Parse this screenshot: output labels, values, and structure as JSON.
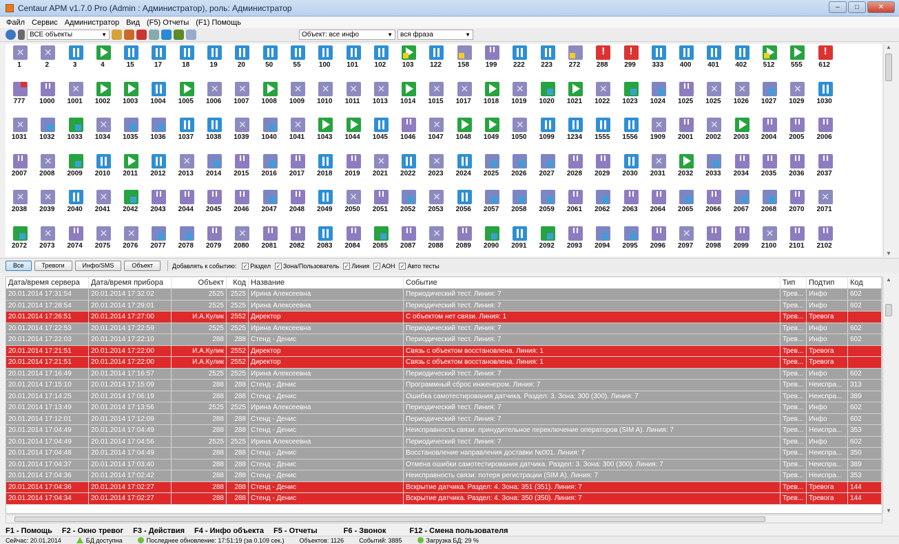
{
  "window": {
    "title": "Centaur APM v1.7.0 Pro (Admin : Администратор), роль: Администратор",
    "min": "–",
    "max": "□",
    "close": "✕"
  },
  "menu": [
    "Файл",
    "Сервис",
    "Администратор",
    "Вид",
    "(F5) Отчеты",
    "(F1) Помощь"
  ],
  "toolbar": {
    "objects_combo": "ВСЕ объекты",
    "event_combo": "Объект: все инфо",
    "phrase_combo": "вся фраза",
    "combo_arrow": "▼"
  },
  "icons": [
    "globe-icon",
    "objects-icon",
    "user-icon",
    "group-icon",
    "close-icon",
    "list-icon",
    "info-icon",
    "export-icon",
    "search-icon"
  ],
  "grid": {
    "rows": [
      [
        [
          "1",
          "cross"
        ],
        [
          "2",
          "cross"
        ],
        [
          "3",
          "pause"
        ],
        [
          "4",
          "play"
        ],
        [
          "15",
          "pause"
        ],
        [
          "17",
          "pause"
        ],
        [
          "18",
          "pause"
        ],
        [
          "19",
          "pause"
        ],
        [
          "20",
          "pause"
        ],
        [
          "50",
          "pause"
        ],
        [
          "55",
          "pause"
        ],
        [
          "100",
          "pause"
        ],
        [
          "101",
          "pause"
        ],
        [
          "102",
          "pause"
        ],
        [
          "103",
          "gplayf"
        ],
        [
          "122",
          "pause"
        ],
        [
          "158",
          "pxf"
        ],
        [
          "199",
          "split"
        ],
        [
          "222",
          "pause"
        ],
        [
          "223",
          "pause"
        ],
        [
          "272",
          "pxf"
        ],
        [
          "288",
          "alarm"
        ],
        [
          "299",
          "alarm"
        ],
        [
          "333",
          "pause"
        ],
        [
          "400",
          "pause"
        ],
        [
          "401",
          "pause"
        ],
        [
          "402",
          "pause"
        ],
        [
          "512",
          "gplayf"
        ],
        [
          "555",
          "play"
        ],
        [
          "612",
          "alarm"
        ]
      ],
      [
        [
          "777",
          "redtop"
        ],
        [
          "1000",
          "split"
        ],
        [
          "1001",
          "cross"
        ],
        [
          "1002",
          "play"
        ],
        [
          "1003",
          "play"
        ],
        [
          "1004",
          "pause"
        ],
        [
          "1005",
          "play"
        ],
        [
          "1006",
          "cross"
        ],
        [
          "1007",
          "cross"
        ],
        [
          "1008",
          "play"
        ],
        [
          "1009",
          "cross"
        ],
        [
          "1010",
          "cross"
        ],
        [
          "1011",
          "cross"
        ],
        [
          "1013",
          "cross"
        ],
        [
          "1014",
          "play"
        ],
        [
          "1015",
          "cross"
        ],
        [
          "1017",
          "cross"
        ],
        [
          "1018",
          "play"
        ],
        [
          "1019",
          "cross"
        ],
        [
          "1020",
          "tri"
        ],
        [
          "1021",
          "play"
        ],
        [
          "1022",
          "cross"
        ],
        [
          "1023",
          "tri"
        ],
        [
          "1024",
          "bar"
        ],
        [
          "1025",
          "split"
        ],
        [
          "1025",
          "cross"
        ],
        [
          "1026",
          "cross"
        ],
        [
          "1027",
          "bar"
        ],
        [
          "1029",
          "cross"
        ],
        [
          "1030",
          "pause"
        ]
      ],
      [
        [
          "1031",
          "cross"
        ],
        [
          "1032",
          "bar"
        ],
        [
          "1033",
          "tri"
        ],
        [
          "1034",
          "cross"
        ],
        [
          "1035",
          "bar"
        ],
        [
          "1036",
          "bar"
        ],
        [
          "1037",
          "pause"
        ],
        [
          "1038",
          "pause"
        ],
        [
          "1039",
          "cross"
        ],
        [
          "1040",
          "bar"
        ],
        [
          "1041",
          "cross"
        ],
        [
          "1043",
          "play"
        ],
        [
          "1044",
          "play"
        ],
        [
          "1045",
          "pause"
        ],
        [
          "1046",
          "split"
        ],
        [
          "1047",
          "cross"
        ],
        [
          "1048",
          "play"
        ],
        [
          "1049",
          "play"
        ],
        [
          "1050",
          "cross"
        ],
        [
          "1099",
          "pause"
        ],
        [
          "1234",
          "pause"
        ],
        [
          "1555",
          "pause"
        ],
        [
          "1556",
          "pause"
        ],
        [
          "1909",
          "cross"
        ],
        [
          "2001",
          "split"
        ],
        [
          "2002",
          "cross"
        ],
        [
          "2003",
          "play"
        ],
        [
          "2004",
          "split"
        ],
        [
          "2005",
          "split"
        ],
        [
          "2006",
          "split"
        ]
      ],
      [
        [
          "2007",
          "split"
        ],
        [
          "2008",
          "cross"
        ],
        [
          "2009",
          "tri"
        ],
        [
          "2010",
          "pause"
        ],
        [
          "2011",
          "play"
        ],
        [
          "2012",
          "pause"
        ],
        [
          "2013",
          "cross"
        ],
        [
          "2014",
          "bar"
        ],
        [
          "2015",
          "split"
        ],
        [
          "2016",
          "bar"
        ],
        [
          "2017",
          "split"
        ],
        [
          "2018",
          "pause"
        ],
        [
          "2019",
          "split"
        ],
        [
          "2021",
          "cross"
        ],
        [
          "2022",
          "pause"
        ],
        [
          "2023",
          "cross"
        ],
        [
          "2024",
          "pause"
        ],
        [
          "2025",
          "bar"
        ],
        [
          "2026",
          "bar"
        ],
        [
          "2027",
          "bar"
        ],
        [
          "2028",
          "split"
        ],
        [
          "2029",
          "split"
        ],
        [
          "2030",
          "pause"
        ],
        [
          "2031",
          "cross"
        ],
        [
          "2032",
          "play"
        ],
        [
          "2033",
          "bar"
        ],
        [
          "2034",
          "split"
        ],
        [
          "2035",
          "split"
        ],
        [
          "2036",
          "split"
        ],
        [
          "2037",
          "split"
        ]
      ],
      [
        [
          "2038",
          "cross"
        ],
        [
          "2039",
          "cross"
        ],
        [
          "2040",
          "pause"
        ],
        [
          "2041",
          "cross"
        ],
        [
          "2042",
          "tri"
        ],
        [
          "2043",
          "split"
        ],
        [
          "2044",
          "split"
        ],
        [
          "2045",
          "split"
        ],
        [
          "2046",
          "split"
        ],
        [
          "2047",
          "bar"
        ],
        [
          "2048",
          "split"
        ],
        [
          "2049",
          "pause"
        ],
        [
          "2050",
          "cross"
        ],
        [
          "2051",
          "split"
        ],
        [
          "2052",
          "bar"
        ],
        [
          "2053",
          "cross"
        ],
        [
          "2056",
          "pause"
        ],
        [
          "2057",
          "bar"
        ],
        [
          "2058",
          "bar"
        ],
        [
          "2059",
          "bar"
        ],
        [
          "2061",
          "split"
        ],
        [
          "2062",
          "bar"
        ],
        [
          "2063",
          "split"
        ],
        [
          "2064",
          "split"
        ],
        [
          "2065",
          "bar"
        ],
        [
          "2066",
          "split"
        ],
        [
          "2067",
          "bar"
        ],
        [
          "2068",
          "bar"
        ],
        [
          "2070",
          "split"
        ],
        [
          "2071",
          "cross"
        ]
      ],
      [
        [
          "2072",
          "tri"
        ],
        [
          "2073",
          "cross"
        ],
        [
          "2074",
          "split"
        ],
        [
          "2075",
          "cross"
        ],
        [
          "2076",
          "cross"
        ],
        [
          "2077",
          "bar"
        ],
        [
          "2078",
          "bar"
        ],
        [
          "2079",
          "split"
        ],
        [
          "2080",
          "cross"
        ],
        [
          "2081",
          "split"
        ],
        [
          "2082",
          "split"
        ],
        [
          "2083",
          "pause"
        ],
        [
          "2084",
          "split"
        ],
        [
          "2085",
          "tri"
        ],
        [
          "2087",
          "split"
        ],
        [
          "2088",
          "cross"
        ],
        [
          "2089",
          "split"
        ],
        [
          "2090",
          "tri"
        ],
        [
          "2091",
          "pause"
        ],
        [
          "2092",
          "tri"
        ],
        [
          "2093",
          "split"
        ],
        [
          "2094",
          "bar"
        ],
        [
          "2095",
          "bar"
        ],
        [
          "2096",
          "split"
        ],
        [
          "2097",
          "cross"
        ],
        [
          "2098",
          "split"
        ],
        [
          "2099",
          "split"
        ],
        [
          "2100",
          "cross"
        ],
        [
          "2101",
          "split"
        ],
        [
          "2102",
          "split"
        ]
      ]
    ]
  },
  "filter": {
    "buttons": [
      "Все",
      "Тревоги",
      "Инфо/SMS",
      "Объект"
    ],
    "add_label": "Добавлять к событию:",
    "checks": [
      "Раздел",
      "Зона/Пользователь",
      "Линия",
      "АОН",
      "Авто тесты"
    ],
    "check_mark": "✓"
  },
  "table": {
    "headers": [
      "Дата/время сервера",
      "Дата/время прибора",
      "Объект",
      "Код",
      "Название",
      "Событие",
      "Тип",
      "Подтип",
      "Код"
    ],
    "rows": [
      {
        "s": "20.01.2014  17:31:54",
        "d": "20.01.2014  17:32:02",
        "o": "2525",
        "k": "2525",
        "n": "Ирина Алексеевна",
        "e": "Периодический тест. Линия: 7",
        "t": "Трев...",
        "p": "Инфо",
        "c": "602",
        "red": false
      },
      {
        "s": "20.01.2014  17:28:54",
        "d": "20.01.2014  17:29:01",
        "o": "2525",
        "k": "2525",
        "n": "Ирина Алексеевна",
        "e": "Периодический тест. Линия: 7",
        "t": "Трев...",
        "p": "Инфо",
        "c": "602",
        "red": false
      },
      {
        "s": "20.01.2014  17:26:51",
        "d": "20.01.2014  17:27:00",
        "o": "И.А.Кулик",
        "k": "2552",
        "n": "Директор",
        "e": "С объектом нет связи. Линия: 1",
        "t": "Трев...",
        "p": "Тревога",
        "c": "",
        "red": true
      },
      {
        "s": "20.01.2014  17:22:53",
        "d": "20.01.2014  17:22:59",
        "o": "2525",
        "k": "2525",
        "n": "Ирина Алексеевна",
        "e": "Периодический тест. Линия: 7",
        "t": "Трев...",
        "p": "Инфо",
        "c": "602",
        "red": false
      },
      {
        "s": "20.01.2014  17:22:03",
        "d": "20.01.2014  17:22:10",
        "o": "288",
        "k": "288",
        "n": "Стенд - Денис",
        "e": "Периодический тест. Линия: 7",
        "t": "Трев...",
        "p": "Инфо",
        "c": "602",
        "red": false
      },
      {
        "s": "20.01.2014  17:21:51",
        "d": "20.01.2014  17:22:00",
        "o": "И.А.Кулик",
        "k": "2552",
        "n": "Директор",
        "e": "Связь с объектом восстановлена. Линия: 1",
        "t": "Трев...",
        "p": "Тревога",
        "c": "",
        "red": true
      },
      {
        "s": "20.01.2014  17:21:51",
        "d": "20.01.2014  17:22:00",
        "o": "И.А.Кулик",
        "k": "2552",
        "n": "Директор",
        "e": "Связь с объектом восстановлена. Линия: 1",
        "t": "Трев...",
        "p": "Тревога",
        "c": "",
        "red": true
      },
      {
        "s": "20.01.2014  17:16:49",
        "d": "20.01.2014  17:16:57",
        "o": "2525",
        "k": "2525",
        "n": "Ирина Алексеевна",
        "e": "Периодический тест. Линия: 7",
        "t": "Трев...",
        "p": "Инфо",
        "c": "602",
        "red": false
      },
      {
        "s": "20.01.2014  17:15:10",
        "d": "20.01.2014  17:15:09",
        "o": "288",
        "k": "288",
        "n": "Стенд - Денис",
        "e": "Программный сброс инженером. Линия: 7",
        "t": "Трев...",
        "p": "Неиспра...",
        "c": "313",
        "red": false
      },
      {
        "s": "20.01.2014  17:14:25",
        "d": "20.01.2014  17:06:19",
        "o": "288",
        "k": "288",
        "n": "Стенд - Денис",
        "e": "Ошибка самотестирования датчика. Раздел: 3. Зона: 300 (300). Линия: 7",
        "t": "Трев...",
        "p": "Неиспра...",
        "c": "389",
        "red": false
      },
      {
        "s": "20.01.2014  17:13:49",
        "d": "20.01.2014  17:13:56",
        "o": "2525",
        "k": "2525",
        "n": "Ирина Алексеевна",
        "e": "Периодический тест. Линия: 7",
        "t": "Трев...",
        "p": "Инфо",
        "c": "602",
        "red": false
      },
      {
        "s": "20.01.2014  17:12:01",
        "d": "20.01.2014  17:12:09",
        "o": "288",
        "k": "288",
        "n": "Стенд - Денис",
        "e": "Периодический тест. Линия: 7",
        "t": "Трев...",
        "p": "Инфо",
        "c": "602",
        "red": false
      },
      {
        "s": "20.01.2014  17:04:49",
        "d": "20.01.2014  17:04:49",
        "o": "288",
        "k": "288",
        "n": "Стенд - Денис",
        "e": "Неисправность связи: принудительное переключение операторов (SIM A). Линия: 7",
        "t": "Трев...",
        "p": "Неиспра...",
        "c": "353",
        "red": false
      },
      {
        "s": "20.01.2014  17:04:49",
        "d": "20.01.2014  17:04:56",
        "o": "2525",
        "k": "2525",
        "n": "Ирина Алексеевна",
        "e": "Периодический тест. Линия: 7",
        "t": "Трев...",
        "p": "Инфо",
        "c": "602",
        "red": false
      },
      {
        "s": "20.01.2014  17:04:48",
        "d": "20.01.2014  17:04:49",
        "o": "288",
        "k": "288",
        "n": "Стенд - Денис",
        "e": "Восстановление направления доставки №001. Линия: 7",
        "t": "Трев...",
        "p": "Неиспра...",
        "c": "350",
        "red": false
      },
      {
        "s": "20.01.2014  17:04:37",
        "d": "20.01.2014  17:03:40",
        "o": "288",
        "k": "288",
        "n": "Стенд - Денис",
        "e": "Отмена ошибки самотестирования датчика. Раздел: 3. Зона: 300 (300). Линия: 7",
        "t": "Трев...",
        "p": "Неиспра...",
        "c": "389",
        "red": false
      },
      {
        "s": "20.01.2014  17:04:36",
        "d": "20.01.2014  17:02:42",
        "o": "288",
        "k": "288",
        "n": "Стенд - Денис",
        "e": "Неисправность связи: потеря регистрации (SIM A). Линия: 7",
        "t": "Трев...",
        "p": "Неиспра...",
        "c": "353",
        "red": false
      },
      {
        "s": "20.01.2014  17:04:36",
        "d": "20.01.2014  17:02:27",
        "o": "288",
        "k": "288",
        "n": "Стенд - Денис",
        "e": "Вскрытие датчика. Раздел: 4. Зона: 351 (351). Линия: 7",
        "t": "Трев...",
        "p": "Тревога",
        "c": "144",
        "red": true
      },
      {
        "s": "20.01.2014  17:04:34",
        "d": "20.01.2014  17:02:27",
        "o": "288",
        "k": "288",
        "n": "Стенд - Денис",
        "e": "Вскрытие датчика. Раздел: 4. Зона: 350 (350). Линия: 7",
        "t": "Трев...",
        "p": "Тревога",
        "c": "144",
        "red": true
      }
    ]
  },
  "hotkeys": [
    "F1 - Помощь",
    "F2 - Окно тревог",
    "F3 - Действия",
    "F4 - Инфо объекта",
    "F5 - Отчеты",
    "F6 - Звонок",
    "F12 - Смена пользователя"
  ],
  "status": {
    "now": "Сейчас: 20.01.2014",
    "db": "БД доступна",
    "updated": "Последнее обновление: 17:51:19  (за 0.109 сек.)",
    "objects": "Объектов: 1126",
    "events": "Событий: 3885",
    "load": "Загрузка БД: 29 %"
  },
  "colors": {
    "alarm_row": "#de2a2a",
    "normal_row": "#a3a3a3",
    "accent": "#2f8fd3"
  }
}
